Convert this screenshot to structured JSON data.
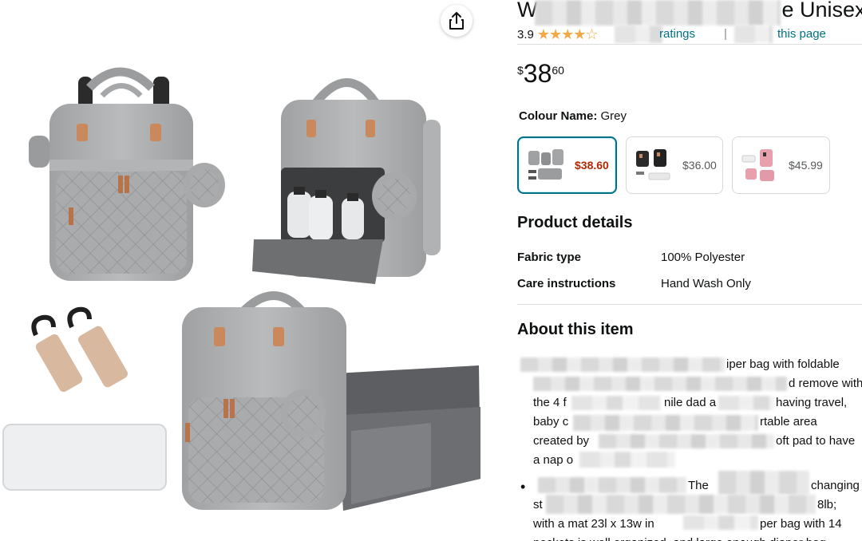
{
  "gallery": {
    "share_icon": "share-icon",
    "images": [
      "backpack-front-grey",
      "backpack-open-bottles",
      "stroller-hooks",
      "changing-pad",
      "backpack-with-bassinet"
    ]
  },
  "product": {
    "title_start": "W",
    "title_end": "e Unisex",
    "rating_value": "3.9",
    "stars": "★★★★☆",
    "ratings_fragment": "ratings",
    "separator": "|",
    "search_fragment": "this page",
    "price_symbol": "$",
    "price_whole": "38",
    "price_fraction": "60"
  },
  "colour": {
    "label": "Colour Name:",
    "value": "Grey",
    "swatches": [
      {
        "price": "$38.60",
        "selected": true
      },
      {
        "price": "$36.00",
        "selected": false
      },
      {
        "price": "$45.99",
        "selected": false
      }
    ]
  },
  "product_details": {
    "heading": "Product details",
    "rows": [
      {
        "key": "Fabric type",
        "value": "100% Polyester"
      },
      {
        "key": "Care instructions",
        "value": "Hand Wash Only"
      }
    ]
  },
  "about": {
    "heading": "About this item",
    "lines": [
      "iper bag with foldable",
      "d remove with",
      "the 4 f",
      "nile dad a",
      "having travel,",
      "baby c",
      "rtable area",
      "created by",
      "oft pad to have",
      "a nap o",
      "The",
      "changing",
      "st",
      "8lb;",
      "with a mat 23l x 13w in",
      "per bag with 14",
      "pockets is well organized, and large enough diaper bag"
    ]
  },
  "colors": {
    "link": "#007185",
    "price_red": "#b12704",
    "star": "#f3a847",
    "selected_border": "#007185"
  }
}
